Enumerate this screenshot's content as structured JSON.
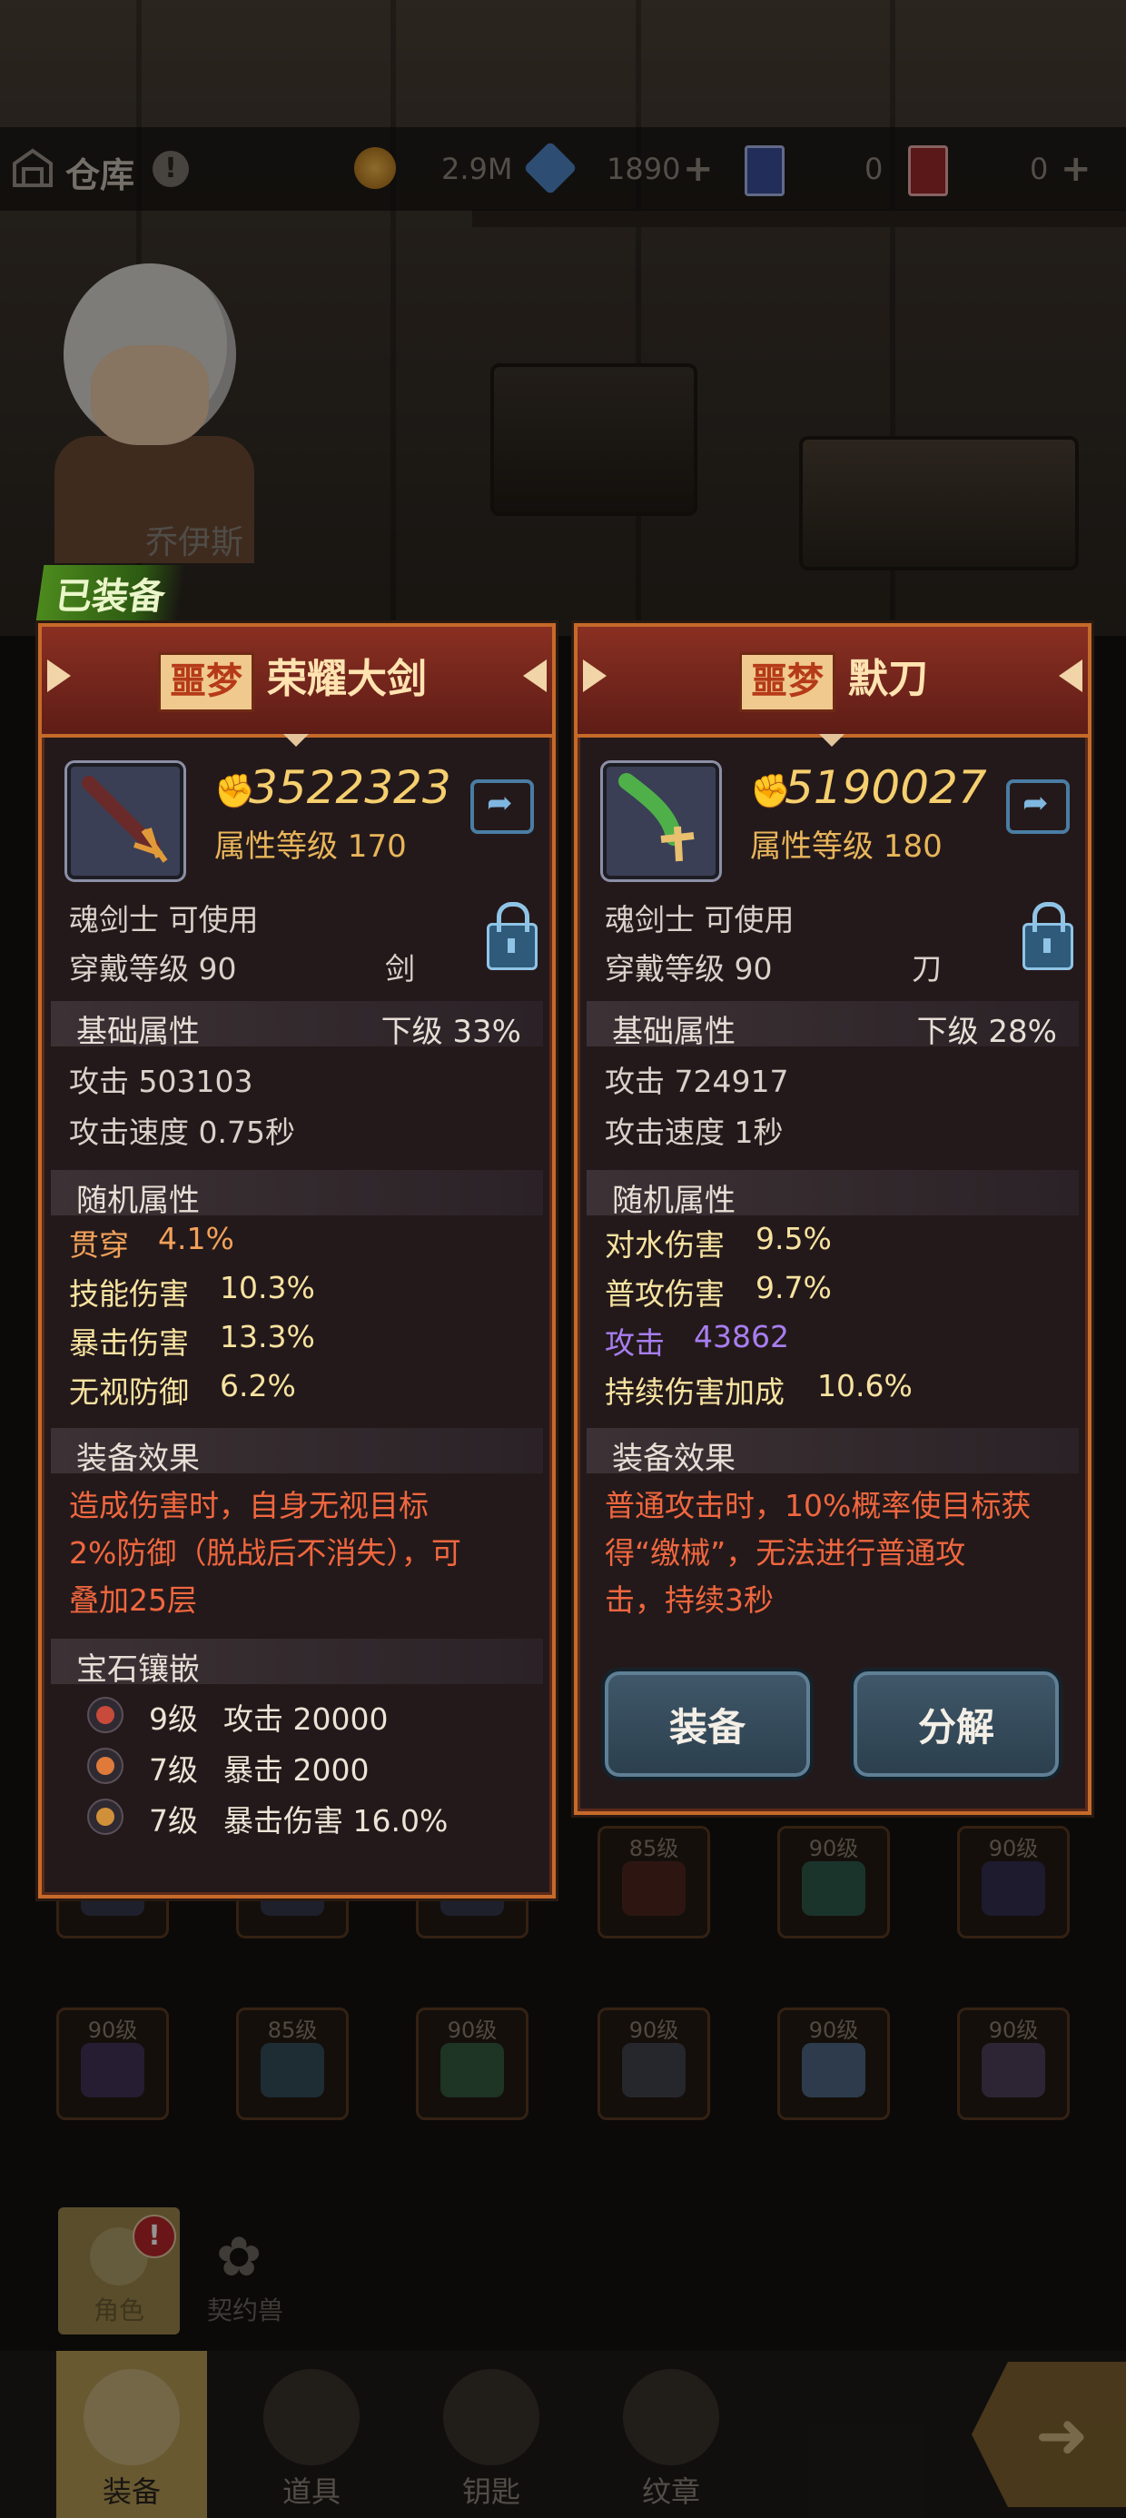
{
  "topbar": {
    "warehouse_label": "仓库",
    "info_mark": "!",
    "gold": "2.9M",
    "diamonds": "1890",
    "blue_tickets": "0",
    "red_tickets": "0",
    "plus": "+"
  },
  "hero_name": "乔伊斯",
  "equipped_tag": "已装备",
  "left_item": {
    "rarity": "噩梦",
    "name": "荣耀大剑",
    "power": "3522323",
    "attr_level": "属性等级 170",
    "class_usable": "魂剑士 可使用",
    "wear_level": "穿戴等级 90",
    "weapon_type": "剑",
    "base_title": "基础属性",
    "base_grade": "下级 33%",
    "base_stats": [
      "攻击  503103",
      "攻击速度  0.75秒"
    ],
    "random_title": "随机属性",
    "random_stats": [
      {
        "label": "贯穿",
        "value": "4.1%",
        "color": "#f2a25a"
      },
      {
        "label": "技能伤害",
        "value": "10.3%",
        "color": "#f7e3a0"
      },
      {
        "label": "暴击伤害",
        "value": "13.3%",
        "color": "#f7e3a0"
      },
      {
        "label": "无视防御",
        "value": "6.2%",
        "color": "#f7e3a0"
      }
    ],
    "effect_title": "装备效果",
    "effect_lines": [
      "造成伤害时，自身无视目标",
      "2%防御（脱战后不消失），可",
      "叠加25层"
    ],
    "gem_title": "宝石镶嵌",
    "gems": [
      {
        "level": "9级",
        "stat": "攻击 20000",
        "color": "#c84a3a"
      },
      {
        "level": "7级",
        "stat": "暴击 2000",
        "color": "#e07a3a"
      },
      {
        "level": "7级",
        "stat": "暴击伤害 16.0%",
        "color": "#d0903a"
      }
    ]
  },
  "right_item": {
    "rarity": "噩梦",
    "name": "默刀",
    "power": "5190027",
    "attr_level": "属性等级 180",
    "class_usable": "魂剑士 可使用",
    "wear_level": "穿戴等级 90",
    "weapon_type": "刀",
    "base_title": "基础属性",
    "base_grade": "下级 28%",
    "base_stats": [
      "攻击  724917",
      "攻击速度  1秒"
    ],
    "random_title": "随机属性",
    "random_stats": [
      {
        "label": "对水伤害",
        "value": "9.5%",
        "color": "#f7e3a0"
      },
      {
        "label": "普攻伤害",
        "value": "9.7%",
        "color": "#f7e3a0"
      },
      {
        "label": "攻击",
        "value": "43862",
        "color": "#a77ef0"
      },
      {
        "label": "持续伤害加成",
        "value": "10.6%",
        "color": "#f7e3a0"
      }
    ],
    "effect_title": "装备效果",
    "effect_lines": [
      "普通攻击时，10%概率使目标获",
      "得“缴械”，无法进行普通攻",
      "击，持续3秒"
    ],
    "equip_button": "装备",
    "dismantle_button": "分解"
  },
  "inventory_levels": [
    "85级",
    "90级",
    "90级",
    "90级",
    "85级",
    "90级",
    "90级",
    "90级",
    "90级"
  ],
  "side_tabs": {
    "role": "角色",
    "role_badge": "!",
    "pet": "契约兽"
  },
  "bottom_nav": [
    "装备",
    "道具",
    "钥匙",
    "纹章"
  ],
  "colors": {
    "accent_border": "#c66a2a",
    "effect_text": "#f0673f",
    "power_text": "#f6cf6e"
  }
}
